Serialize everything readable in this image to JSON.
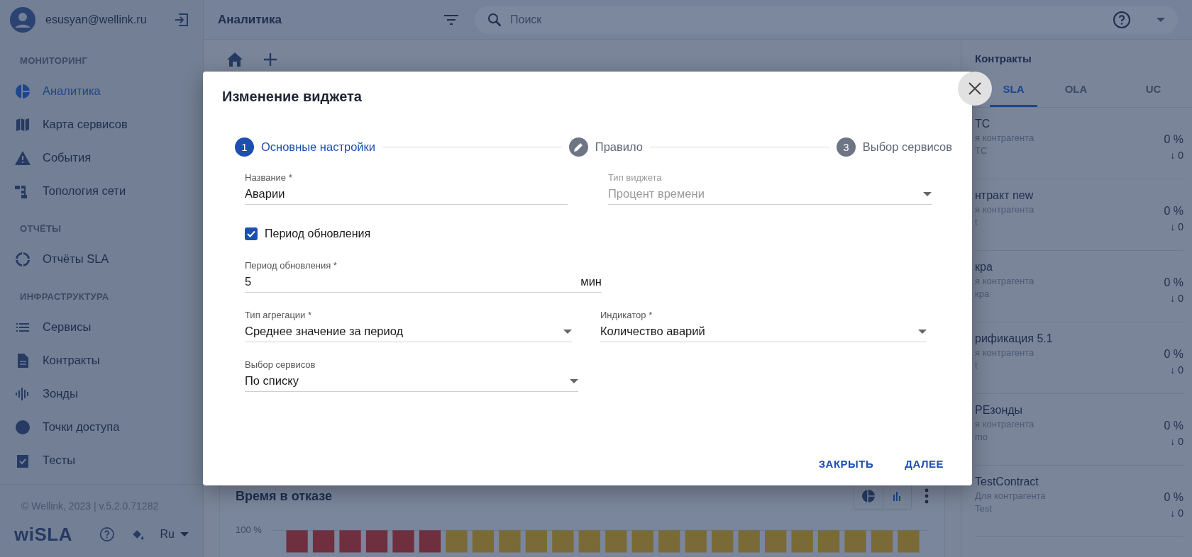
{
  "sidebar": {
    "user": {
      "email": "esusyan@wellink.ru"
    },
    "sections": [
      {
        "title": "МОНИТОРИНГ",
        "items": [
          {
            "label": "Аналитика",
            "selected": true
          },
          {
            "label": "Карта сервисов",
            "selected": false
          },
          {
            "label": "События",
            "selected": false
          },
          {
            "label": "Топология сети",
            "selected": false
          }
        ]
      },
      {
        "title": "ОТЧЁТЫ",
        "items": [
          {
            "label": "Отчёты SLA",
            "selected": false
          }
        ]
      },
      {
        "title": "ИНФРАСТРУКТУРА",
        "items": [
          {
            "label": "Сервисы",
            "selected": false
          },
          {
            "label": "Контракты",
            "selected": false
          },
          {
            "label": "Зонды",
            "selected": false
          },
          {
            "label": "Точки доступа",
            "selected": false
          },
          {
            "label": "Тесты",
            "selected": false
          }
        ]
      }
    ],
    "footer": {
      "copyright": "© Wellink, 2023 | v.5.2.0.71282",
      "logo": "wiSLA",
      "language": "Ru"
    }
  },
  "top_bar": {
    "title": "Аналитика",
    "search": {
      "placeholder": "Поиск"
    }
  },
  "dashboard": {
    "widget": {
      "title": "Время в отказе",
      "y_tick": "100 %"
    }
  },
  "contracts_panel": {
    "title": "Контракты",
    "tabs": [
      {
        "label": "SLA",
        "selected": true
      },
      {
        "label": "OLA",
        "selected": false
      },
      {
        "label": "UC",
        "selected": false
      }
    ],
    "items": [
      {
        "name": "ТС",
        "type": "я контрагента",
        "counterparty": "ТС",
        "percent": "0 %",
        "count": "↓ 0"
      },
      {
        "name": "нтракт new",
        "type": "я контрагента",
        "counterparty": "t",
        "percent": "0 %",
        "count": "↓ 0"
      },
      {
        "name": "кра",
        "type": "я контрагента",
        "counterparty": "кра",
        "percent": "0 %",
        "count": "↓ 0"
      },
      {
        "name": "рификация 5.1",
        "type": "я контрагента",
        "counterparty": "t",
        "percent": "0 %",
        "count": "↓ 0"
      },
      {
        "name": "РЕзонды",
        "type": "я контрагента",
        "counterparty": "mo",
        "percent": "0 %",
        "count": "↓ 0"
      },
      {
        "name": "TestContract",
        "type": "Для контрагента",
        "counterparty": "Test",
        "percent": "0 %",
        "count": "↓ 0"
      }
    ]
  },
  "dialog": {
    "title": "Изменение виджета",
    "steps": [
      {
        "kind": "number",
        "number": "1",
        "label": "Основные настройки",
        "selected": true
      },
      {
        "kind": "edit",
        "label": "Правило",
        "selected": false
      },
      {
        "kind": "number",
        "number": "3",
        "label": "Выбор сервисов",
        "selected": false
      }
    ],
    "name": {
      "label": "Название *",
      "value": "Аварии"
    },
    "widget_type": {
      "label": "Тип виджета",
      "value": "Процент времени",
      "disabled": true
    },
    "update_toggle": {
      "label": "Период обновления",
      "checked": true
    },
    "update_period": {
      "label": "Период обновления *",
      "value": "5",
      "suffix": "мин"
    },
    "aggregation": {
      "label": "Тип агрегации *",
      "value": "Среднее значение за период"
    },
    "indicator": {
      "label": "Индикатор *",
      "value": "Количество аварий"
    },
    "services": {
      "label": "Выбор сервисов",
      "value": "По списку"
    },
    "buttons": [
      "ЗАКРЫТЬ",
      "ДАЛЕЕ"
    ]
  }
}
